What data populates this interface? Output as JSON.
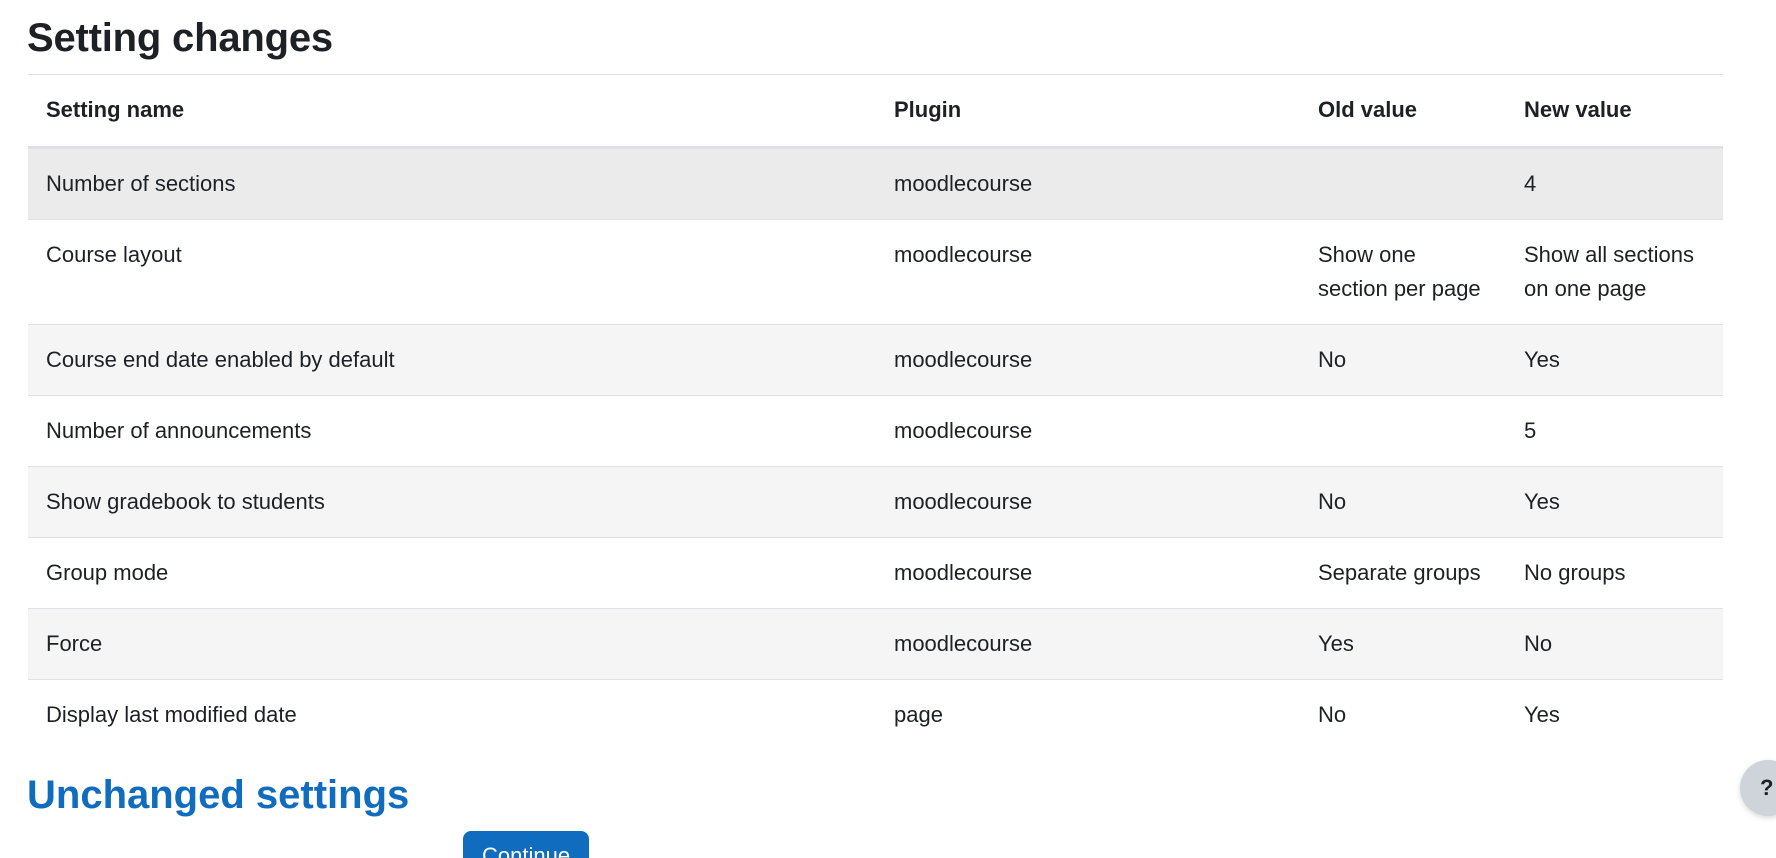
{
  "heading": "Setting changes",
  "table": {
    "headers": [
      "Setting name",
      "Plugin",
      "Old value",
      "New value"
    ],
    "rows": [
      {
        "name": "Number of sections",
        "plugin": "moodlecourse",
        "old": "",
        "new": "4"
      },
      {
        "name": "Course layout",
        "plugin": "moodlecourse",
        "old": "Show one section per page",
        "new": "Show all sections on one page"
      },
      {
        "name": "Course end date enabled by default",
        "plugin": "moodlecourse",
        "old": "No",
        "new": "Yes"
      },
      {
        "name": "Number of announcements",
        "plugin": "moodlecourse",
        "old": "",
        "new": "5"
      },
      {
        "name": "Show gradebook to students",
        "plugin": "moodlecourse",
        "old": "No",
        "new": "Yes"
      },
      {
        "name": "Group mode",
        "plugin": "moodlecourse",
        "old": "Separate groups",
        "new": "No groups"
      },
      {
        "name": "Force",
        "plugin": "moodlecourse",
        "old": "Yes",
        "new": "No"
      },
      {
        "name": "Display last modified date",
        "plugin": "page",
        "old": "No",
        "new": "Yes"
      }
    ]
  },
  "unchanged_link": "Unchanged settings",
  "continue_label": "Continue",
  "help_label": "?",
  "colors": {
    "accent": "#0f6cbf",
    "text": "#1d2125",
    "stripe": "#f5f5f5",
    "border": "#dee2e6"
  }
}
